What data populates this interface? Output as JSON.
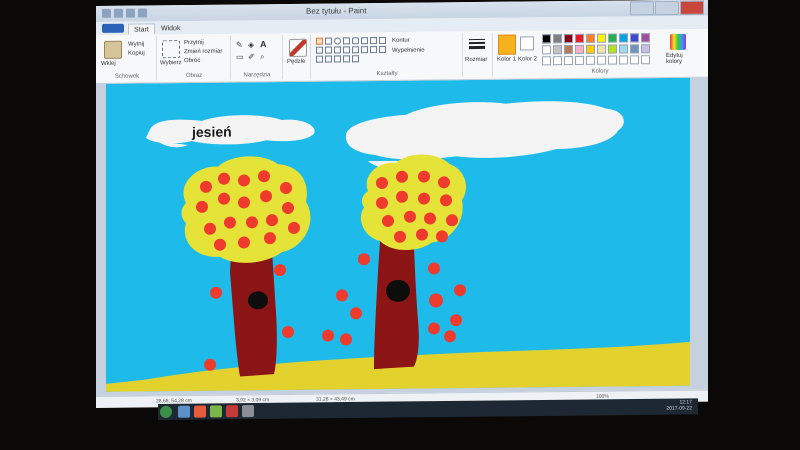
{
  "window": {
    "title": "Bez tytułu - Paint"
  },
  "tabs": [
    {
      "label": "Start",
      "active": true
    },
    {
      "label": "Widok",
      "active": false
    }
  ],
  "ribbon": {
    "clipboard": {
      "paste_label": "Wklej",
      "cut_label": "Wytnij",
      "copy_label": "Kopiuj",
      "group_label": "Schowek"
    },
    "image": {
      "select_label": "Wybierz",
      "crop_label": "Przytnij",
      "resize_label": "Zmień rozmiar",
      "rotate_label": "Obróć",
      "group_label": "Obraz"
    },
    "tools": {
      "group_label": "Narzędzia"
    },
    "brushes": {
      "label": "Pędzle"
    },
    "shapes": {
      "outline_label": "Kontur",
      "fill_label": "Wypełnienie",
      "group_label": "Kształty"
    },
    "size": {
      "label": "Rozmiar"
    },
    "colors": {
      "color1_label": "Kolor 1",
      "color2_label": "Kolor 2",
      "edit_label": "Edytuj kolory",
      "group_label": "Kolory",
      "color1": "#f5b21c",
      "color2": "#ffffff",
      "palette": [
        "#000000",
        "#7f7f7f",
        "#880015",
        "#ed1c24",
        "#ff7f27",
        "#fff200",
        "#22b14c",
        "#00a2e8",
        "#3f48cc",
        "#a349a4",
        "#ffffff",
        "#c3c3c3",
        "#b97a57",
        "#ffaec9",
        "#ffc90e",
        "#efe4b0",
        "#b5e61d",
        "#99d9ea",
        "#7092be",
        "#c8bfe7",
        "#ffffff",
        "#ffffff",
        "#ffffff",
        "#ffffff",
        "#ffffff",
        "#ffffff",
        "#ffffff",
        "#ffffff",
        "#ffffff",
        "#ffffff"
      ]
    }
  },
  "canvas": {
    "cloud_text": "jesień",
    "sky_color": "#1ebbea",
    "ground_color": "#e3d22e",
    "foliage_color": "#e6e338",
    "trunk_color": "#8b1414",
    "fruit_color": "#ef3a2e",
    "cloud_color": "#f4f4f4"
  },
  "statusbar": {
    "cursor": "28,68, 54,28 cm",
    "selection": "3,92 × 3,09 cm",
    "size": "31,28 × 43,49 cm",
    "zoom": "100%"
  },
  "taskbar": {
    "time": "12:17",
    "date": "2017-09-22"
  }
}
